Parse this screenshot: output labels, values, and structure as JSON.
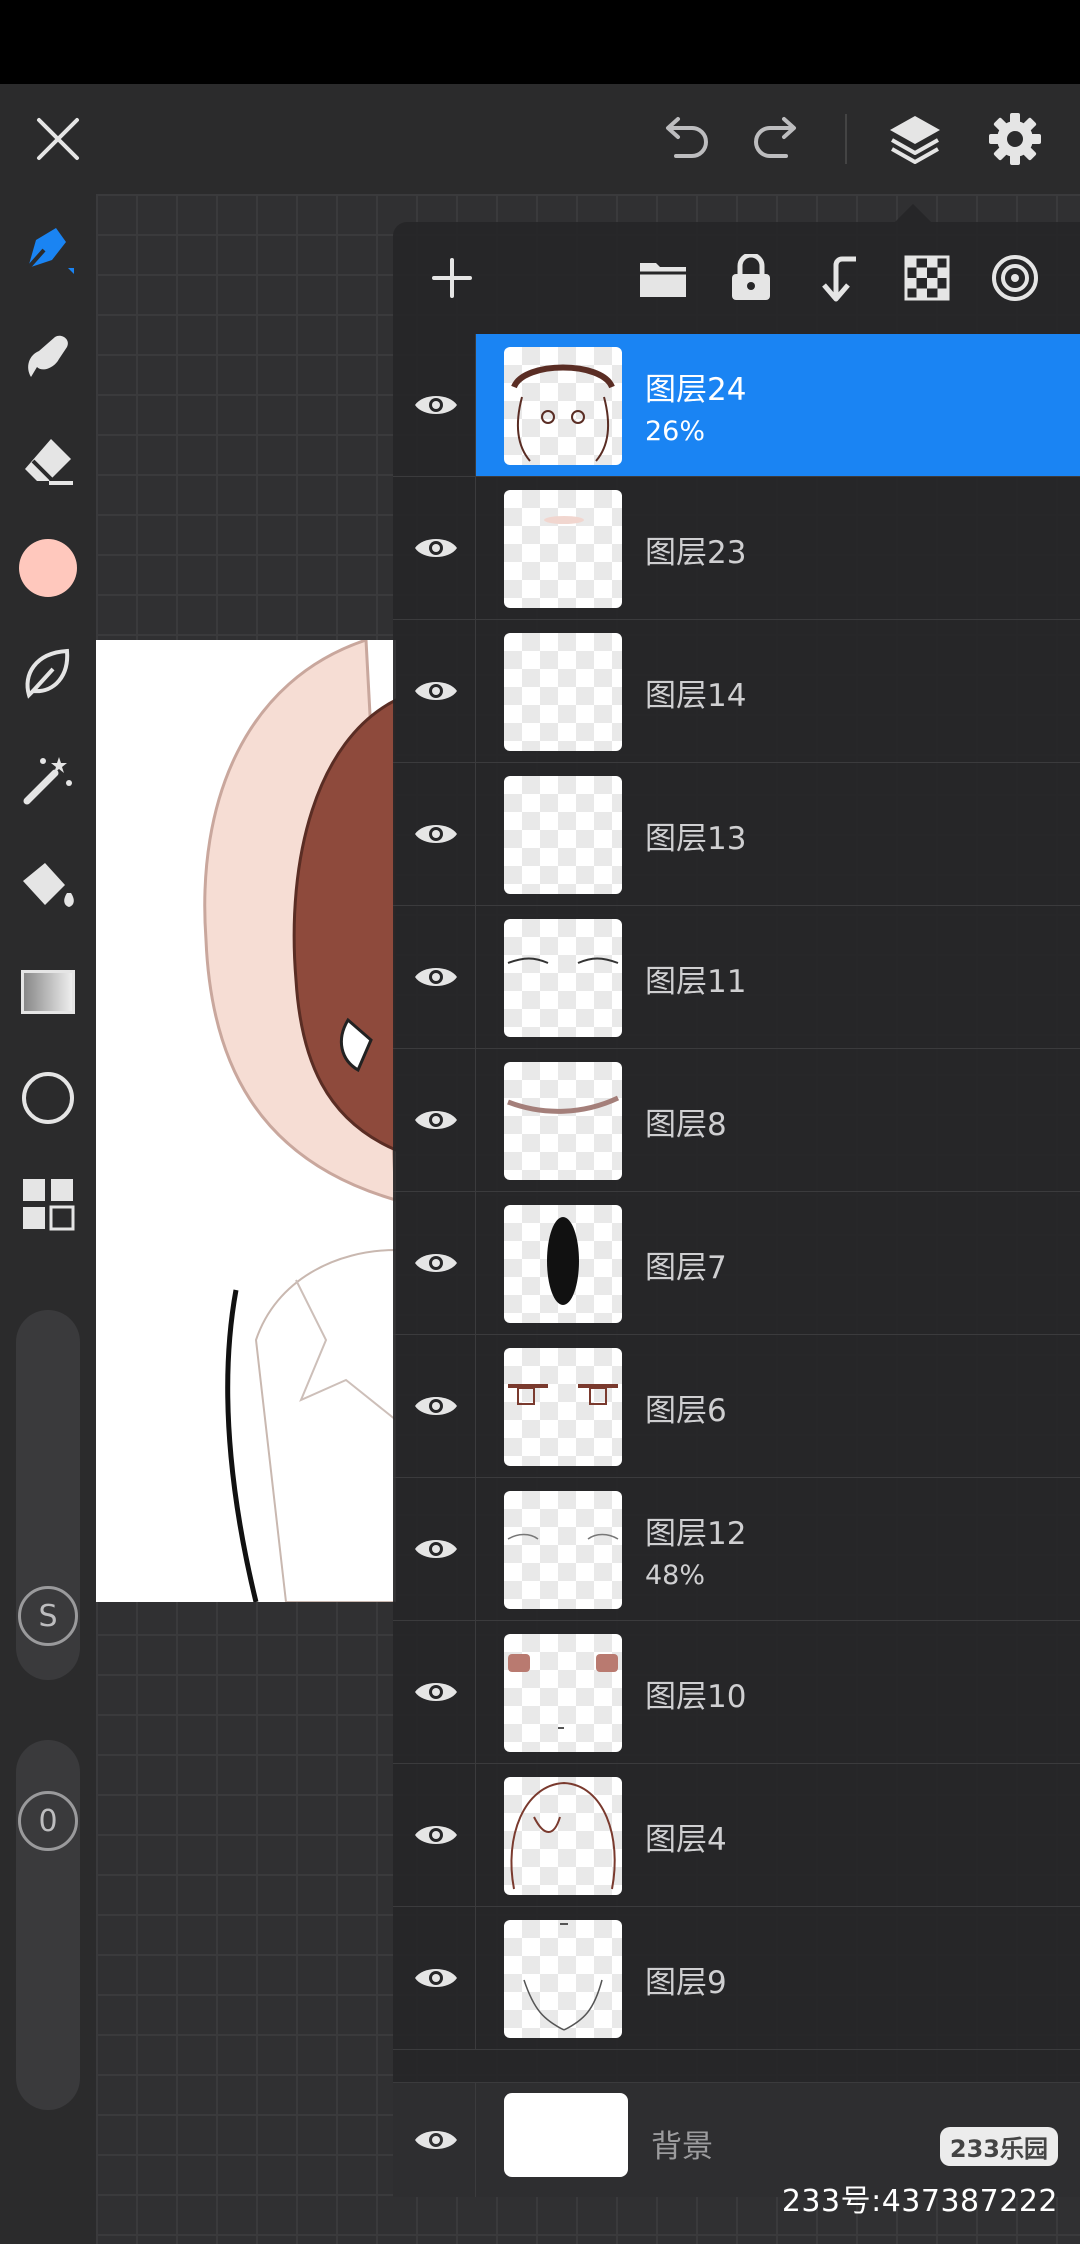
{
  "top_bar": {
    "icons": [
      "close-icon",
      "undo-icon",
      "redo-icon",
      "layers-icon",
      "settings-icon"
    ]
  },
  "sidebar": {
    "tools": [
      "brush-icon",
      "smudge-icon",
      "eraser-icon",
      "color-swatch",
      "lasso-icon",
      "magic-wand-icon",
      "fill-bucket-icon",
      "gradient-icon",
      "shape-circle-icon",
      "grid-panels-icon"
    ],
    "current_color": "#ffc8bd",
    "size_label": "S",
    "opacity_label": "0"
  },
  "layers_panel": {
    "toolbar_icons": [
      "add-layer-icon",
      "folder-icon",
      "lock-icon",
      "merge-down-icon",
      "transparency-icon",
      "blend-icon"
    ],
    "layers": [
      {
        "name": "图层24",
        "opacity": "26%",
        "selected": true
      },
      {
        "name": "图层23",
        "opacity": "",
        "selected": false
      },
      {
        "name": "图层14",
        "opacity": "",
        "selected": false
      },
      {
        "name": "图层13",
        "opacity": "",
        "selected": false
      },
      {
        "name": "图层11",
        "opacity": "",
        "selected": false
      },
      {
        "name": "图层8",
        "opacity": "",
        "selected": false
      },
      {
        "name": "图层7",
        "opacity": "",
        "selected": false
      },
      {
        "name": "图层6",
        "opacity": "",
        "selected": false
      },
      {
        "name": "图层12",
        "opacity": "48%",
        "selected": false
      },
      {
        "name": "图层10",
        "opacity": "",
        "selected": false
      },
      {
        "name": "图层4",
        "opacity": "",
        "selected": false
      },
      {
        "name": "图层9",
        "opacity": "",
        "selected": false
      }
    ],
    "background_layer": {
      "name": "背景"
    }
  },
  "watermark": {
    "logo": "233乐园",
    "id_text": "233号:437387222"
  },
  "colors": {
    "accent": "#1a84f3",
    "panel_bg": "#262628"
  }
}
